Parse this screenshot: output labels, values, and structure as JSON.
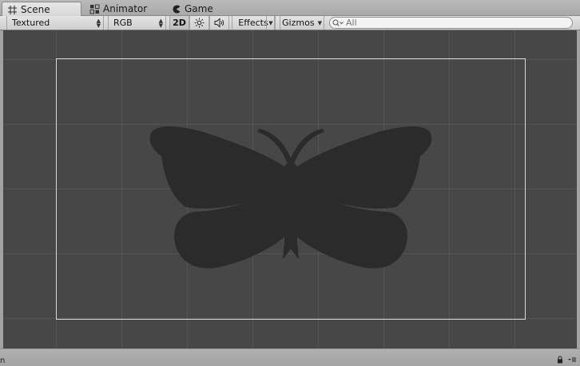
{
  "tabs": [
    {
      "label": "Scene",
      "icon": "grid-icon",
      "active": true
    },
    {
      "label": "Animator",
      "icon": "animator-icon",
      "active": false
    },
    {
      "label": "Game",
      "icon": "pacman-icon",
      "active": false
    }
  ],
  "toolbar": {
    "draw_mode": "Textured",
    "render_mode": "RGB",
    "mode_2d_label": "2D",
    "lighting_icon": "sun-icon",
    "audio_icon": "speaker-icon",
    "effects_label": "Effects",
    "gizmos_label": "Gizmos",
    "search_placeholder": "All"
  },
  "scene": {
    "sprite": "butterfly-silhouette",
    "sprite_color": "#2b2b2b",
    "background_color": "#474747",
    "frame_color": "#d8d8d8"
  },
  "statusbar": {
    "text": "n",
    "icons": [
      "lock-icon",
      "menu-icon"
    ]
  }
}
